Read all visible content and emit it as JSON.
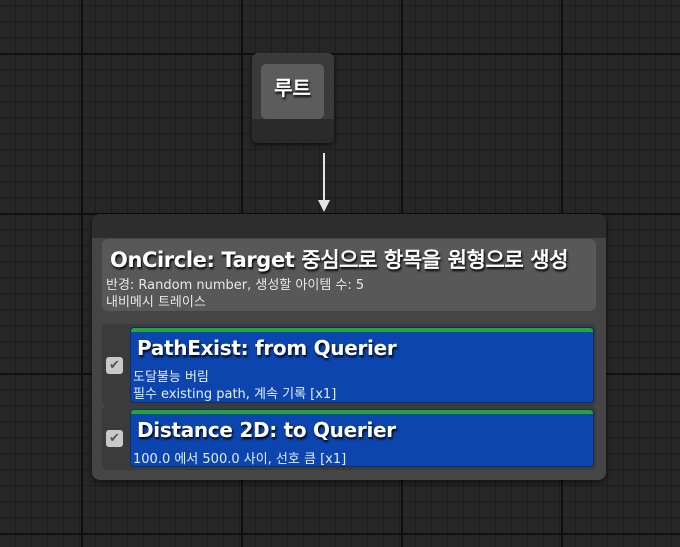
{
  "root": {
    "label": "루트"
  },
  "generator": {
    "title": "OnCircle: Target 중심으로 항목을 원형으로 생성",
    "line1": "반경: Random number, 생성할 아이템 수: 5",
    "line2": "내비메시 트레이스"
  },
  "tests": [
    {
      "title": "PathExist: from Querier",
      "line1": "도달불능 버림",
      "line2": "필수 existing path, 계속 기록 [x1]",
      "checked": true
    },
    {
      "title": "Distance 2D: to Querier",
      "line1": "100.0 에서 500.0 사이, 선호 큼 [x1]",
      "checked": true
    }
  ],
  "colors": {
    "test_card": "#0b45ad",
    "test_bar": "#27a33a",
    "node_body": "#454545",
    "node_header": "#585858"
  },
  "icons": {
    "checkbox": "✔"
  }
}
